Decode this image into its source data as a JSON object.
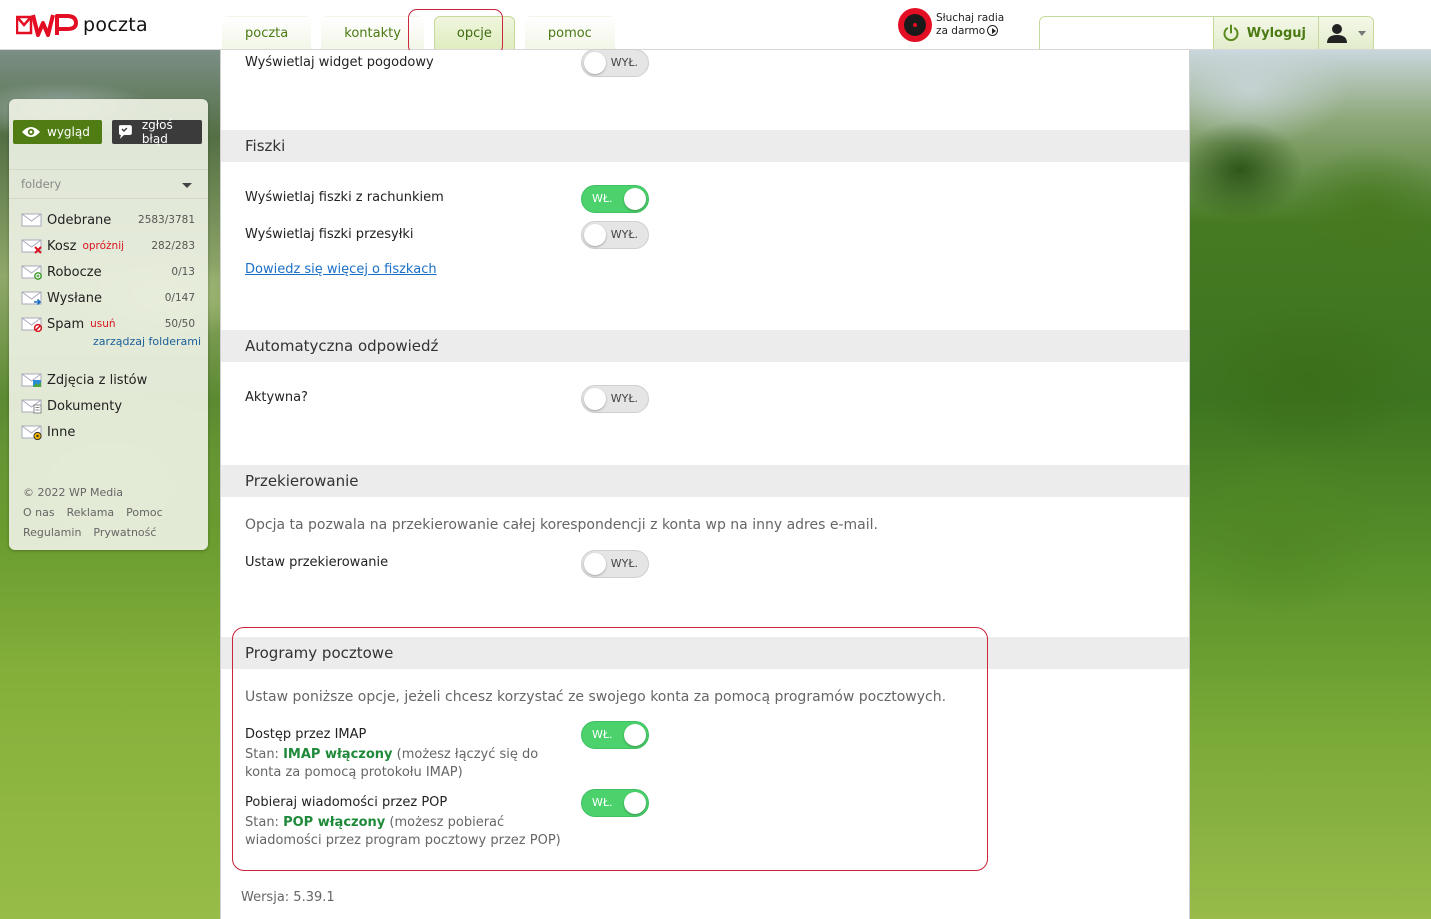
{
  "app": {
    "logo_text": "poczta"
  },
  "nav": {
    "tabs": [
      {
        "label": "poczta",
        "active": false
      },
      {
        "label": "kontakty",
        "active": false
      },
      {
        "label": "opcje",
        "active": true
      },
      {
        "label": "pomoc",
        "active": false
      }
    ]
  },
  "radio": {
    "line1": "Słuchaj radia",
    "line2": "za darmo"
  },
  "user": {
    "logout_label": "Wyloguj"
  },
  "sidebar": {
    "btn_wyglad": "wygląd",
    "btn_zglos": "zgłoś błąd",
    "folders_label": "foldery",
    "folders": [
      {
        "name": "Odebrane",
        "action": "",
        "count": "2583/3781"
      },
      {
        "name": "Kosz",
        "action": "opróżnij",
        "count": "282/283"
      },
      {
        "name": "Robocze",
        "action": "",
        "count": "0/13"
      },
      {
        "name": "Wysłane",
        "action": "",
        "count": "0/147"
      },
      {
        "name": "Spam",
        "action": "usuń",
        "count": "50/50"
      }
    ],
    "manage_link": "zarządzaj folderami",
    "extra_folders": [
      {
        "name": "Zdjęcia z listów"
      },
      {
        "name": "Dokumenty"
      },
      {
        "name": "Inne"
      }
    ],
    "footer": {
      "copyright": "© 2022 WP Media",
      "links1": [
        "O nas",
        "Reklama",
        "Pomoc"
      ],
      "links2": [
        "Regulamin",
        "Prywatność"
      ]
    }
  },
  "content": {
    "weather_widget": {
      "label": "Wyświetlaj widget pogodowy",
      "state": "WYŁ."
    },
    "fiszki": {
      "title": "Fiszki",
      "receipt": {
        "label": "Wyświetlaj fiszki z rachunkiem",
        "state": "WŁ."
      },
      "shipment": {
        "label": "Wyświetlaj fiszki przesyłki",
        "state": "WYŁ."
      },
      "learn_more": "Dowiedz się więcej o fiszkach"
    },
    "autoreply": {
      "title": "Automatyczna odpowiedź",
      "active": {
        "label": "Aktywna?",
        "state": "WYŁ."
      }
    },
    "forwarding": {
      "title": "Przekierowanie",
      "description": "Opcja ta pozwala na przekierowanie całej korespondencji z konta wp na inny adres e-mail.",
      "set": {
        "label": "Ustaw przekierowanie",
        "state": "WYŁ."
      }
    },
    "mail_programs": {
      "title": "Programy pocztowe",
      "description": "Ustaw poniższe opcje, jeżeli chcesz korzystać ze swojego konta za pomocą programów pocztowych.",
      "imap": {
        "label": "Dostęp przez IMAP",
        "state": "WŁ.",
        "status_prefix": "Stan: ",
        "status_value": "IMAP włączony",
        "status_suffix": " (możesz łączyć się do konta za pomocą protokołu IMAP)"
      },
      "pop": {
        "label": "Pobieraj wiadomości przez POP",
        "state": "WŁ.",
        "status_prefix": "Stan: ",
        "status_value": "POP włączony",
        "status_suffix": " (możesz pobierać wiadomości przez program pocztowy przez POP)"
      }
    },
    "version": "Wersja: 5.39.1"
  },
  "colors": {
    "accent": "#4f7d14",
    "toggle_on": "#4bd26d",
    "highlight": "#c9253c"
  }
}
